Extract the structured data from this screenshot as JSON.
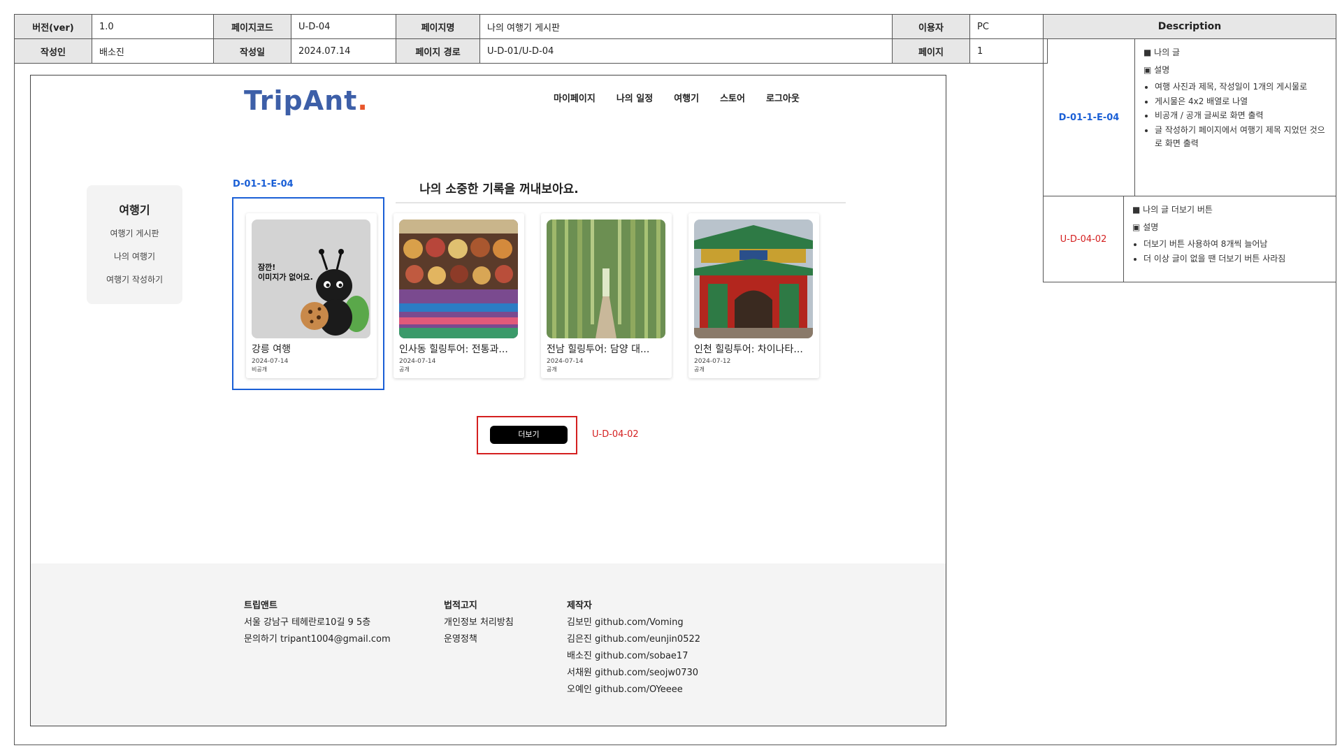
{
  "meta": {
    "version_label": "버전(ver)",
    "version": "1.0",
    "pagecode_label": "페이지코드",
    "pagecode": "U-D-04",
    "pagename_label": "페이지명",
    "pagename": "나의 여행기 게시판",
    "user_label": "이용자",
    "user": "PC",
    "author_label": "작성인",
    "author": "배소진",
    "date_label": "작성일",
    "date": "2024.07.14",
    "path_label": "페이지 경로",
    "path": "U-D-01/U-D-04",
    "page_label": "페이지",
    "page": "1"
  },
  "description": {
    "header": "Description",
    "rows": [
      {
        "id": "D-01-1-E-04",
        "title": "■ 나의 글",
        "subtitle": "▣ 설명",
        "items": [
          "여행 사진과  제목, 작성일이 1개의 게시물로",
          " 게시물은 4x2 배열로 나열",
          "비공개 / 공개 글씨로 화면 출력",
          "글 작성하기 페이지에서 여행기 제목 지었던 것으로 화면 출력"
        ]
      },
      {
        "id": "U-D-04-02",
        "title": "■ 나의 글 더보기 버튼",
        "subtitle": "▣ 설명",
        "items": [
          "더보기 버튼 사용하여 8개씩 늘어남",
          "더 이상  글이 없을 땐 더보기 버튼 사라짐"
        ]
      }
    ]
  },
  "mockup": {
    "logo": "TripAnt",
    "logo_dot": ".",
    "nav": [
      "마이페이지",
      "나의 일정",
      "여행기",
      "스토어",
      "로그아웃"
    ],
    "sidebar": {
      "title": "여행기",
      "items": [
        "여행기 게시판",
        "나의 여행기",
        "여행기 작성하기"
      ]
    },
    "annotation_cards": "D-01-1-E-04",
    "headline": "나의 소중한 기록을 꺼내보아요.",
    "cards": [
      {
        "title": "강릉 여행",
        "date": "2024-07-14",
        "visibility": "비공개",
        "image_text": "잠깐!\n이미지가 없어요."
      },
      {
        "title": "인사동 힐링투어: 전통과...",
        "date": "2024-07-14",
        "visibility": "공개"
      },
      {
        "title": "전남 힐링투어: 담양 대...",
        "date": "2024-07-14",
        "visibility": "공개"
      },
      {
        "title": "인천 힐링투어: 차이나타...",
        "date": "2024-07-12",
        "visibility": "공개"
      }
    ],
    "more_button": "더보기",
    "annotation_more": "U-D-04-02",
    "footer": {
      "col1": {
        "title": "트립앤트",
        "lines": [
          "서울 강남구 테헤란로10길 9 5층",
          "문의하기 tripant1004@gmail.com"
        ]
      },
      "col2": {
        "title": "법적고지",
        "lines": [
          "개인정보 처리방침",
          "운영정책"
        ]
      },
      "col3": {
        "title": "제작자",
        "lines": [
          "김보민 github.com/Voming",
          "김은진 github.com/eunjin0522",
          "배소진 github.com/sobae17",
          "서채원 github.com/seojw0730",
          "오예인 github.com/OYeeee"
        ]
      }
    }
  },
  "colors": {
    "annotation_blue": "#1a5fd6",
    "annotation_red": "#d42020",
    "logo_blue": "#3d5fa8",
    "logo_dot": "#e8562b"
  }
}
